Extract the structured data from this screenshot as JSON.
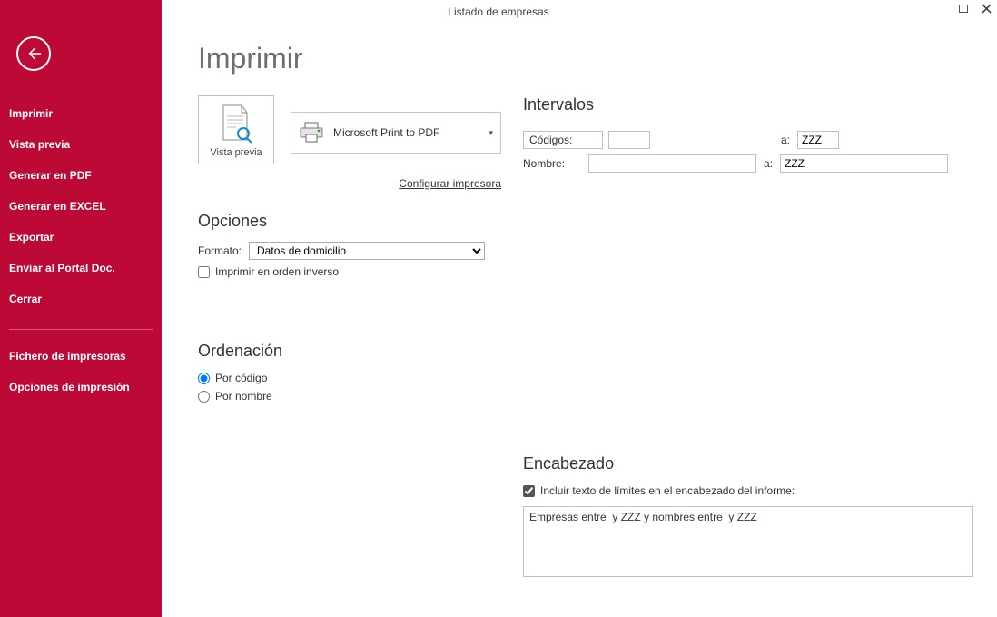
{
  "window": {
    "title": "Listado de empresas"
  },
  "sidebar": {
    "items": [
      "Imprimir",
      "Vista previa",
      "Generar en PDF",
      "Generar en EXCEL",
      "Exportar",
      "Enviar al Portal Doc.",
      "Cerrar"
    ],
    "items2": [
      "Fichero de impresoras",
      "Opciones de impresión"
    ]
  },
  "page": {
    "title": "Imprimir",
    "vista_previa_label": "Vista previa",
    "printer_name": "Microsoft Print to PDF",
    "config_link": "Configurar impresora"
  },
  "opciones": {
    "heading": "Opciones",
    "formato_label": "Formato:",
    "formato_value": "Datos de domicilio",
    "orden_inverso_label": "Imprimir en orden inverso"
  },
  "ordenacion": {
    "heading": "Ordenación",
    "por_codigo": "Por código",
    "por_nombre": "Por nombre"
  },
  "intervalos": {
    "heading": "Intervalos",
    "codigos_label": "Códigos:",
    "nombre_label": "Nombre:",
    "a_label": "a:",
    "codigos_from": "",
    "codigos_to": "ZZZ",
    "nombre_from": "",
    "nombre_to": "ZZZ"
  },
  "encabezado": {
    "heading": "Encabezado",
    "incluir_label": "Incluir texto de límites en el encabezado del informe:",
    "text": "Empresas entre  y ZZZ y nombres entre  y ZZZ"
  }
}
